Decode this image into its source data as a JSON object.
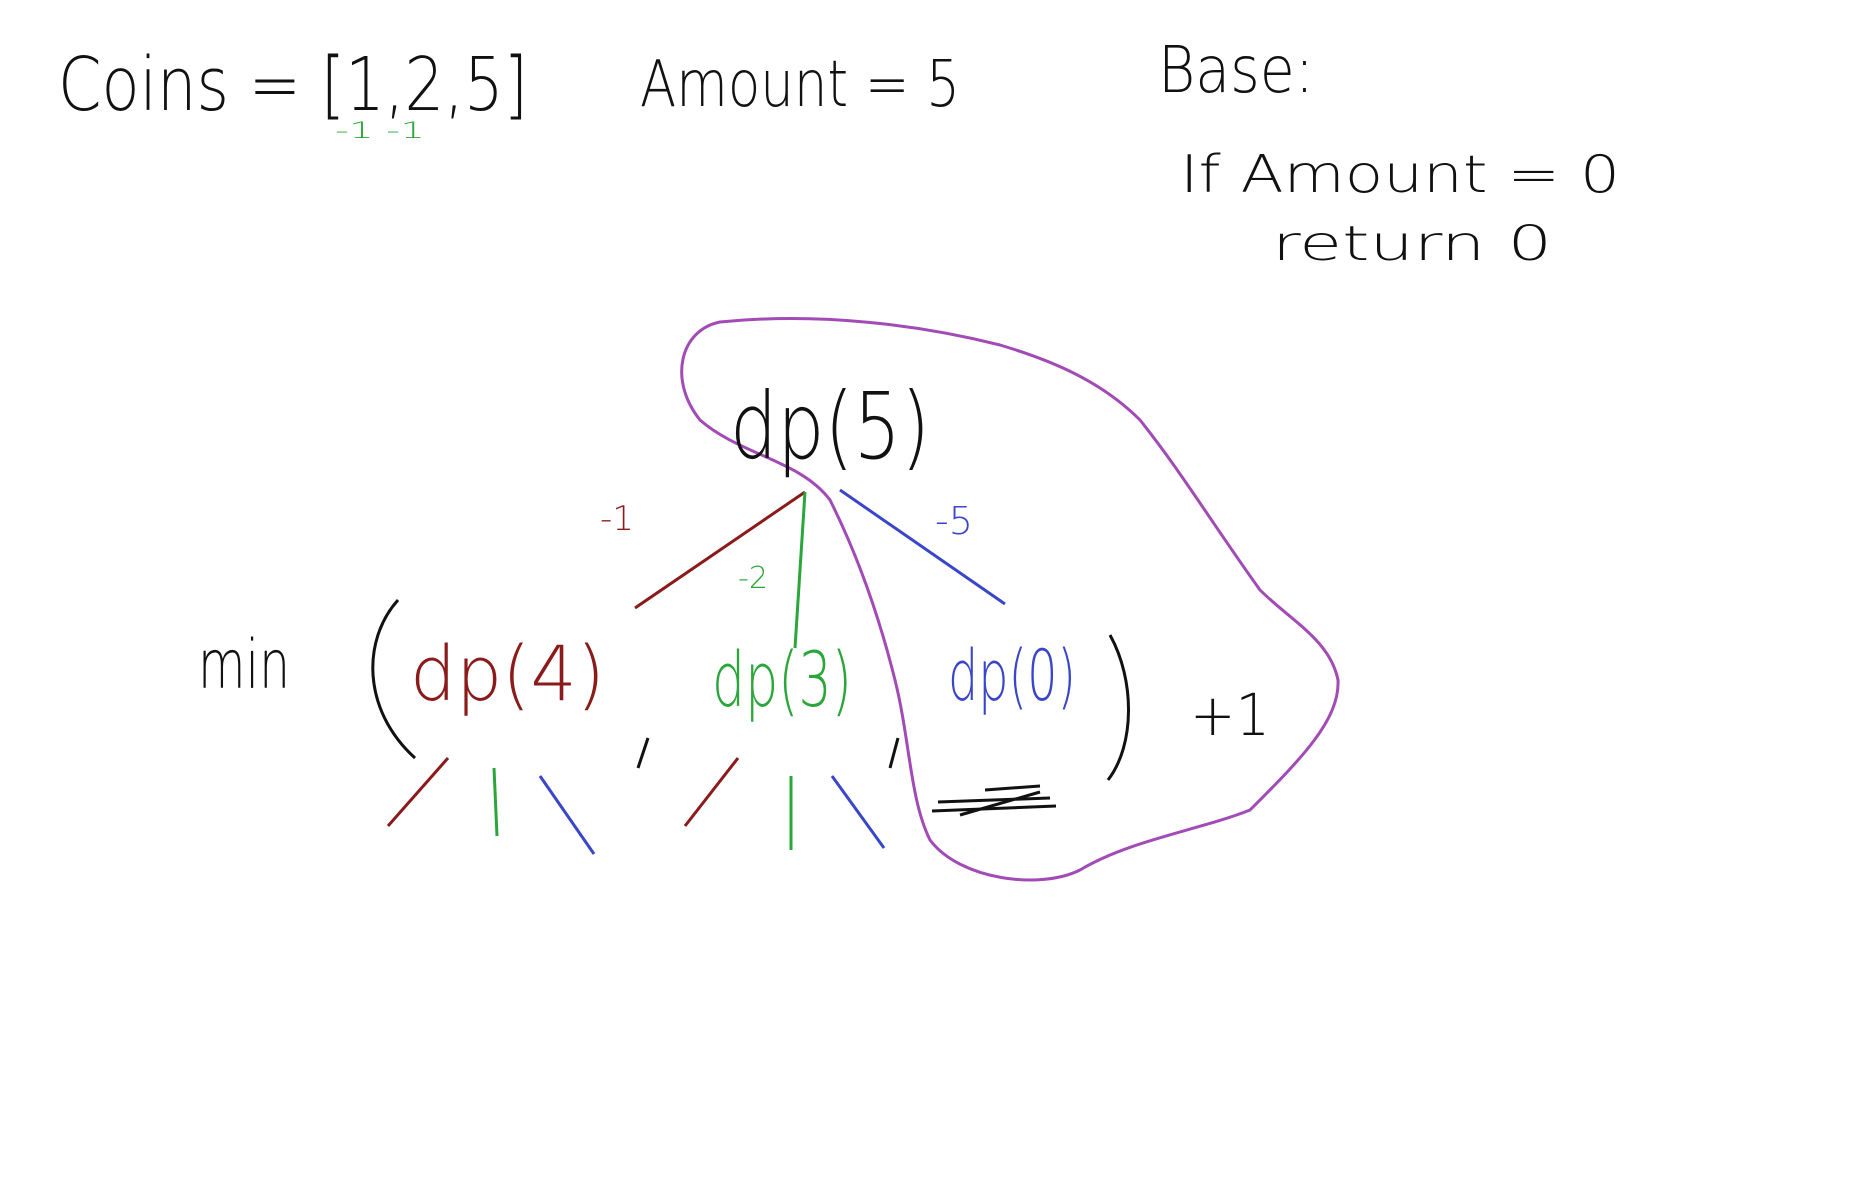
{
  "header": {
    "coins_label": "Coins = [1,2,5]",
    "coins_marks": "-1 -1",
    "amount_label": "Amount = 5",
    "base_title": "Base:",
    "base_condition": "If Amount = 0",
    "base_return": "return 0"
  },
  "tree": {
    "root": "dp(5)",
    "edges": [
      {
        "label": "-1",
        "color": "#8b1a1a"
      },
      {
        "label": "-2",
        "color": "#2aa63a"
      },
      {
        "label": "-5",
        "color": "#3a46c9"
      }
    ],
    "min_label": "min",
    "children": [
      {
        "label": "dp(4)",
        "color": "#8b1a1a"
      },
      {
        "label": "dp(3)",
        "color": "#2aa63a"
      },
      {
        "label": "dp(0)",
        "color": "#3a46c9"
      }
    ],
    "plus_one": "+1"
  },
  "colors": {
    "ink": "#111111",
    "red": "#8b1a1a",
    "green": "#2aa63a",
    "blue": "#3a46c9",
    "highlight": "#a24bb6"
  }
}
